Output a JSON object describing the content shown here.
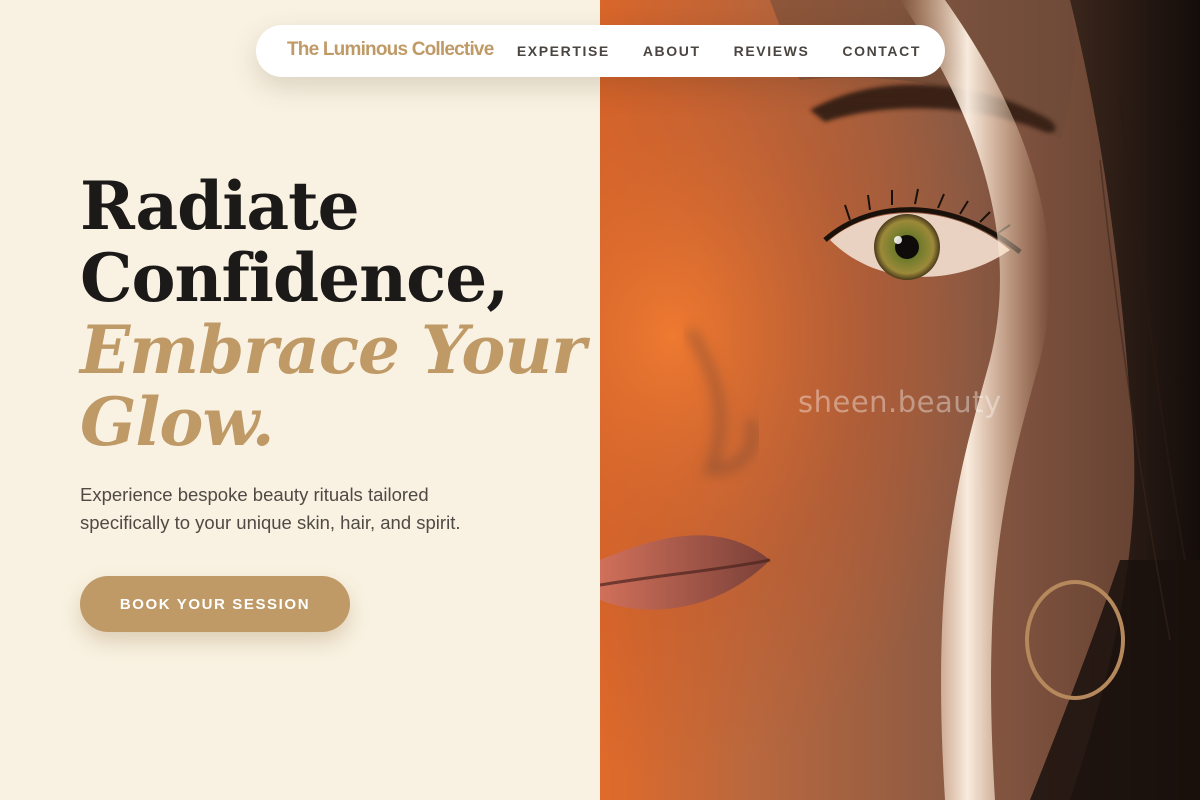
{
  "nav": {
    "brand": "The Luminous Collective",
    "links": [
      {
        "label": "EXPERTISE"
      },
      {
        "label": "ABOUT"
      },
      {
        "label": "REVIEWS"
      },
      {
        "label": "CONTACT"
      }
    ]
  },
  "hero": {
    "headline_line1": "Radiate",
    "headline_line2": "Confidence,",
    "headline_accent_line1": "Embrace Your",
    "headline_accent_line2": "Glow.",
    "subcopy": "Experience bespoke beauty rituals tailored specifically to your unique skin, hair, and spirit.",
    "cta_label": "BOOK YOUR SESSION"
  },
  "photo": {
    "watermark": "sheen.beauty"
  },
  "colors": {
    "background": "#f9f2e2",
    "accent": "#bf9a67",
    "heading": "#1b1a18",
    "body_text": "#4f4a44",
    "nav_text": "#4a4540"
  }
}
